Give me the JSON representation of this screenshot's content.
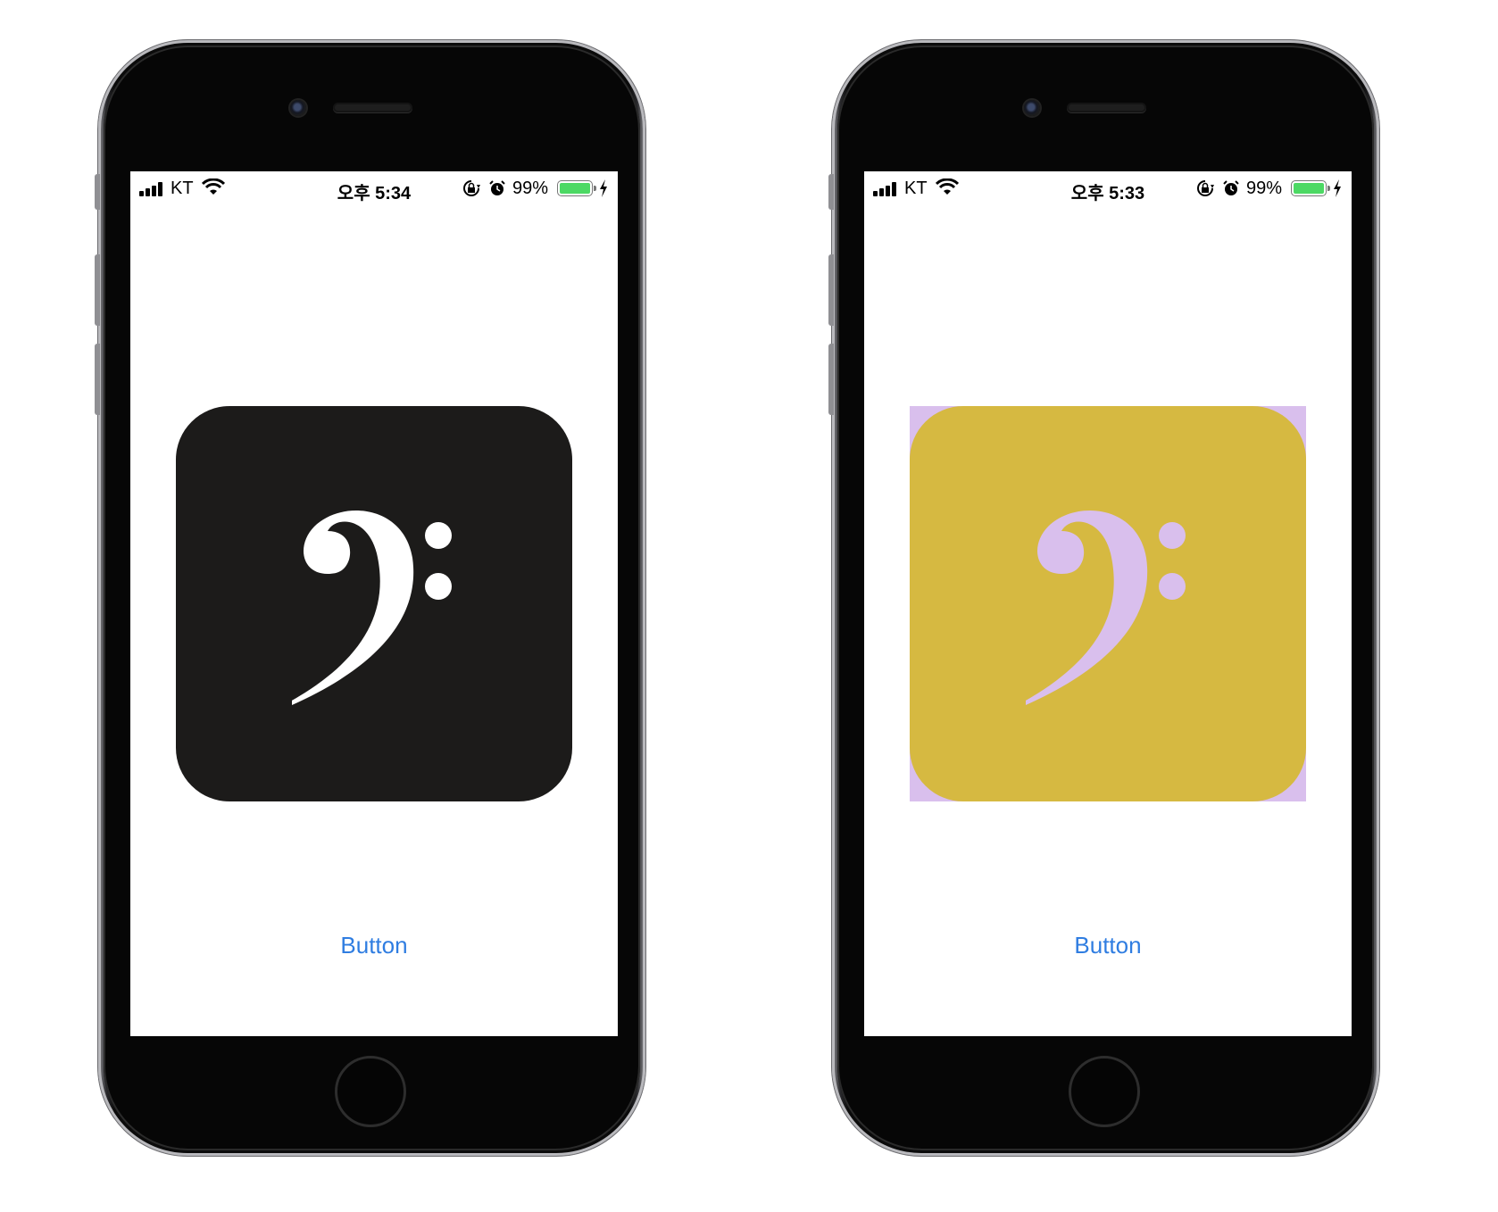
{
  "phones": [
    {
      "status": {
        "carrier": "KT",
        "time": "오후 5:34",
        "battery": "99%"
      },
      "icon": {
        "background": "#1c1b1a",
        "corner_fill": "#ffffff",
        "clef_color": "#ffffff",
        "symbol": "bass-clef-icon"
      },
      "button_label": "Button"
    },
    {
      "status": {
        "carrier": "KT",
        "time": "오후 5:33",
        "battery": "99%"
      },
      "icon": {
        "background": "#d6b941",
        "corner_fill": "#d9bfed",
        "clef_color": "#d9bfed",
        "symbol": "bass-clef-icon"
      },
      "button_label": "Button"
    }
  ],
  "colors": {
    "accent": "#2f7de1",
    "battery_fill": "#4cd964"
  }
}
